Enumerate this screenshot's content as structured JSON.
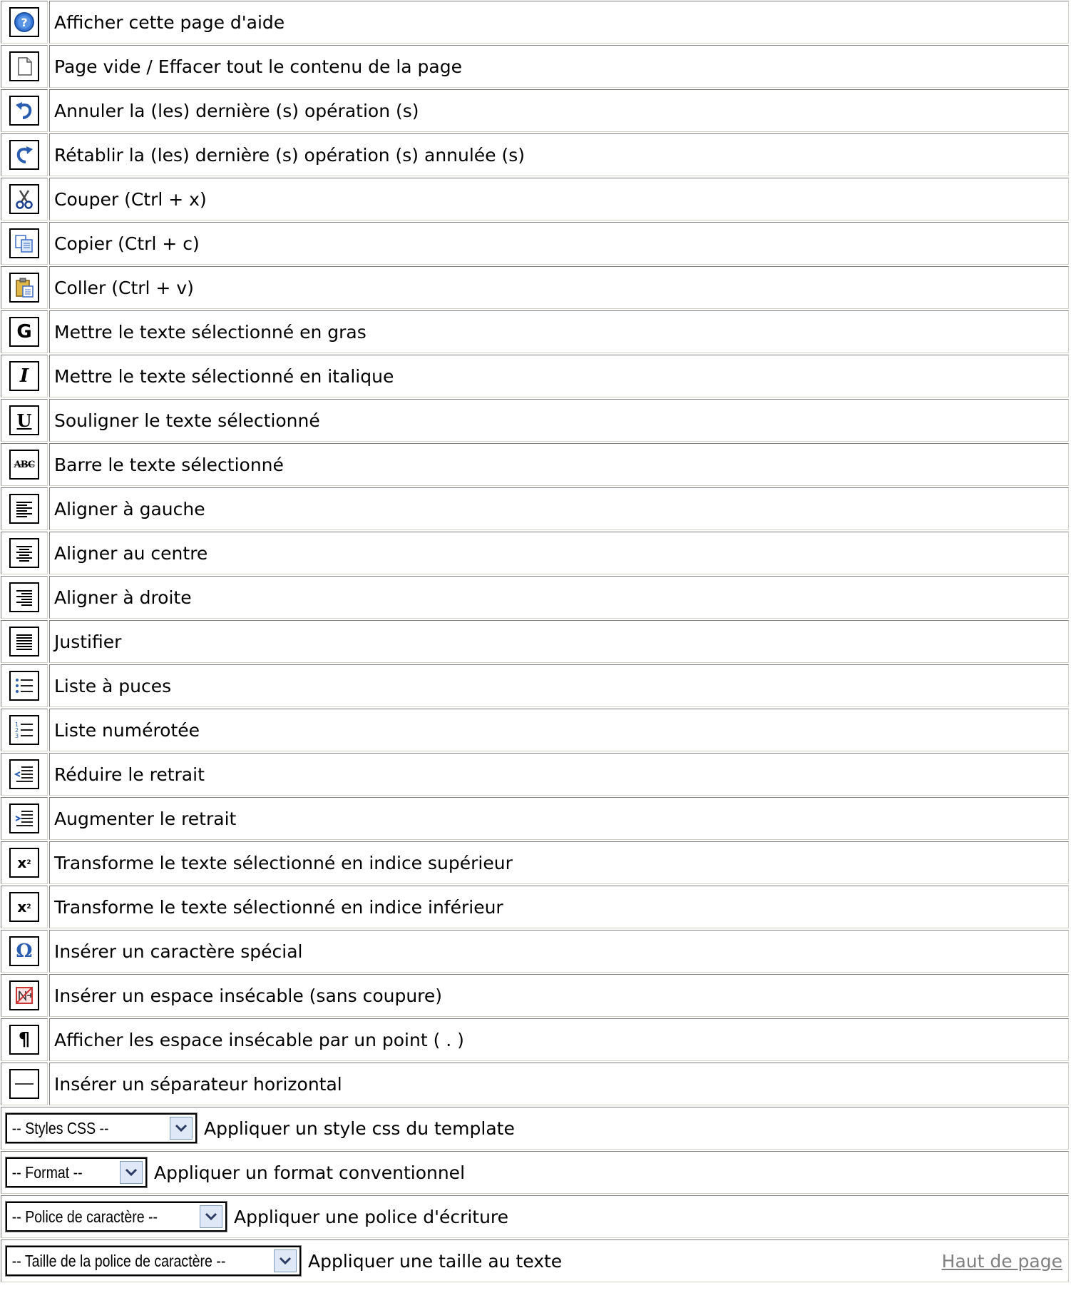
{
  "rows": [
    {
      "icon": "help-icon",
      "text": "Afficher cette page d'aide"
    },
    {
      "icon": "new-page-icon",
      "text": "Page vide / Effacer tout le contenu de la page"
    },
    {
      "icon": "undo-icon",
      "text": "Annuler la (les) dernière (s) opération (s)"
    },
    {
      "icon": "redo-icon",
      "text": "Rétablir la (les) dernière (s) opération (s) annulée (s)"
    },
    {
      "icon": "cut-icon",
      "text": "Couper (Ctrl + x)"
    },
    {
      "icon": "copy-icon",
      "text": "Copier (Ctrl + c)"
    },
    {
      "icon": "paste-icon",
      "text": "Coller (Ctrl + v)"
    },
    {
      "icon": "bold-icon",
      "text": "Mettre le texte sélectionné en gras"
    },
    {
      "icon": "italic-icon",
      "text": "Mettre le texte sélectionné en italique"
    },
    {
      "icon": "underline-icon",
      "text": "Souligner le texte sélectionné"
    },
    {
      "icon": "strikethrough-icon",
      "text": "Barre le texte sélectionné"
    },
    {
      "icon": "align-left-icon",
      "text": "Aligner à gauche"
    },
    {
      "icon": "align-center-icon",
      "text": "Aligner au centre"
    },
    {
      "icon": "align-right-icon",
      "text": "Aligner à droite"
    },
    {
      "icon": "justify-icon",
      "text": "Justifier"
    },
    {
      "icon": "bullet-list-icon",
      "text": "Liste à puces"
    },
    {
      "icon": "numbered-list-icon",
      "text": "Liste numérotée"
    },
    {
      "icon": "outdent-icon",
      "text": "Réduire le retrait"
    },
    {
      "icon": "indent-icon",
      "text": "Augmenter le retrait"
    },
    {
      "icon": "superscript-icon",
      "text": "Transforme le texte sélectionné en indice supérieur"
    },
    {
      "icon": "subscript-icon",
      "text": "Transforme le texte sélectionné en indice inférieur"
    },
    {
      "icon": "special-char-icon",
      "text": "Insérer un caractère spécial"
    },
    {
      "icon": "nbsp-icon",
      "text": "Insérer un espace insécable (sans coupure)"
    },
    {
      "icon": "pilcrow-icon",
      "text": "Afficher les espace insécable par un point ( . )"
    },
    {
      "icon": "horizontal-rule-icon",
      "text": "Insérer un séparateur horizontal"
    }
  ],
  "selects": [
    {
      "value": "-- Styles CSS --",
      "text": "Appliquer un style css du template"
    },
    {
      "value": "-- Format --",
      "text": "Appliquer un format conventionnel"
    },
    {
      "value": "-- Police de caractère --",
      "text": "Appliquer une police d'écriture"
    },
    {
      "value": "-- Taille de la police de caractère --",
      "text": "Appliquer une taille au texte"
    }
  ],
  "top_link": "Haut de page",
  "colors": {
    "link": "#808080",
    "cell_border": "#808080",
    "icon_blue": "#2a5db0"
  }
}
